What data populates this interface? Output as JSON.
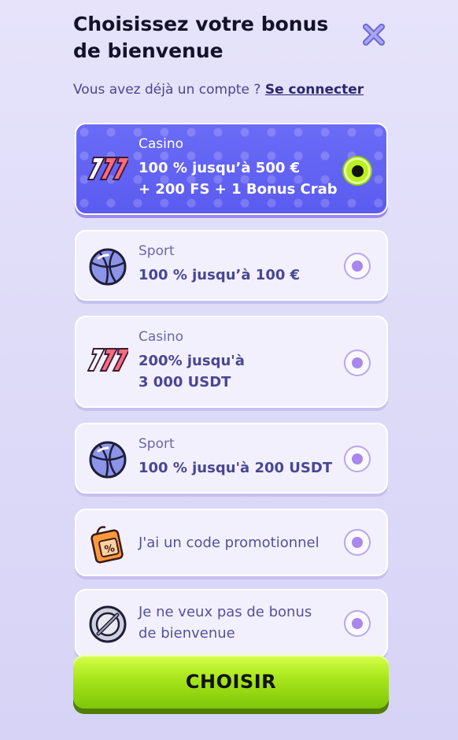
{
  "header": {
    "title": "Choisissez votre bonus de bienvenue",
    "login_prompt": "Vous avez déjà un compte ?",
    "login_link": "Se connecter"
  },
  "options": [
    {
      "category": "Casino",
      "offer_line1": "100 % jusqu’à 500 €",
      "offer_line2": "+ 200 FS + 1 Bonus Crab",
      "icon": "slot-777-icon",
      "selected": true
    },
    {
      "category": "Sport",
      "offer_line1": "100 % jusqu’à 100 €",
      "icon": "basketball-icon",
      "selected": false
    },
    {
      "category": "Casino",
      "offer_line1": "200% jusqu'à",
      "offer_line2": "3 000 USDT",
      "icon": "slot-777-icon",
      "selected": false
    },
    {
      "category": "Sport",
      "offer_line1": "100 % jusqu'à 200 USDT",
      "icon": "basketball-icon",
      "selected": false
    },
    {
      "label": "J'ai un code promotionnel",
      "icon": "promo-tag-icon",
      "selected": false
    },
    {
      "label_line1": "Je ne veux pas de bonus",
      "label_line2": "de bienvenue",
      "icon": "no-bonus-icon",
      "selected": false
    }
  ],
  "cta": {
    "label": "CHOISIR"
  },
  "colors": {
    "selected_card": "#5b5cf0",
    "card_bg": "#f2f0fd",
    "radio_on": "#b9f01e",
    "cta_green": "#a6e51a"
  }
}
